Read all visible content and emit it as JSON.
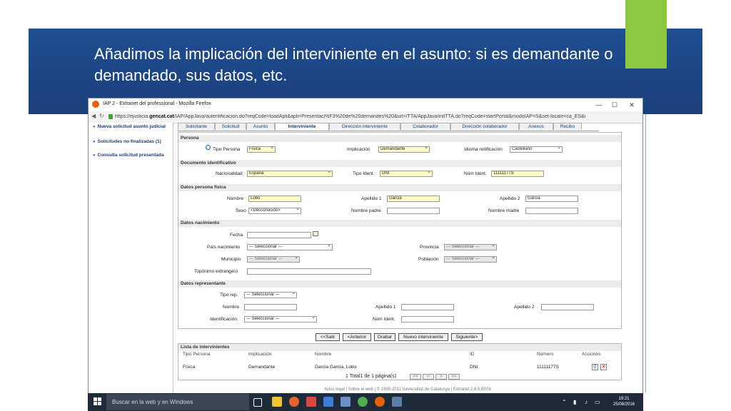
{
  "slide": {
    "title": "Añadimos la implicación del interviniente en el asunto: si es demandante o demandado, sus datos, etc.",
    "accent_color": "#8dc63f",
    "banner_color": "#1f4e93"
  },
  "browser": {
    "window_title": "IAP 2 - Extranet del professional - Mozilla Firefox",
    "url_prefix": "https://ejusticia.",
    "url_domain": "gencat.cat",
    "url_rest": "/IAP/AppJava/autentificacion.do?reqCode=loadApli&apli=Presentaci%F3%20de%20demandes%20&url=/TTA/AppJava/initTTA.do?reqCode=startPortal&modoIAP=S&set-locale=ca_ES&i",
    "minimize": "—",
    "maximize": "☐",
    "close": "✕",
    "back": "◀",
    "refresh": "↻"
  },
  "sidebar": {
    "items": [
      {
        "label": "Nueva solicitud asunto judicial"
      },
      {
        "label": "Solicitudes no finalizadas (1)"
      },
      {
        "label": "Consulta solicitud presentada"
      }
    ],
    "arrow": "»"
  },
  "tabs": [
    {
      "label": "Solicitante"
    },
    {
      "label": "Solicitud"
    },
    {
      "label": "Asunto"
    },
    {
      "label": "Interviniente",
      "active": true
    },
    {
      "label": "Dirección interviniente"
    },
    {
      "label": "Colaborador"
    },
    {
      "label": "Dirección colaborador"
    },
    {
      "label": "Anexos"
    },
    {
      "label": "Recibo"
    }
  ],
  "form": {
    "persona": {
      "section": "Persona",
      "tipo_persona_label": "Tipo Persona",
      "tipo_persona_value": "Física",
      "implicacion_label": "Implicación",
      "implicacion_value": "Demandante",
      "idioma_label": "Idioma notificación",
      "idioma_value": "Castellano"
    },
    "documento": {
      "section": "Documento identificativo",
      "nacionalidad_label": "Nacionalidad",
      "nacionalidad_value": "España",
      "tipo_ident_label": "Tipo Ident.",
      "tipo_ident_value": "DNI",
      "num_ident_label": "Núm Ident.",
      "num_ident_value": "11111177S"
    },
    "fisica": {
      "section": "Datos persona física",
      "nombre_label": "Nombre",
      "nombre_value": "Lobo",
      "apellido1_label": "Apellido 1",
      "apellido1_value": "Garcia",
      "apellido2_label": "Apellido 2",
      "apellido2_value": "Garcia",
      "sexo_label": "Sexo",
      "sexo_value": "<Desconocido>",
      "nombre_padre_label": "Nombre padre",
      "nombre_madre_label": "Nombre madre"
    },
    "nacimiento": {
      "section": "Datos nacimiento",
      "fecha_label": "Fecha",
      "pais_label": "País nacimiento",
      "pais_value": "--- Seleccionar ---",
      "provincia_label": "Provincia",
      "provincia_value": "--- Seleccionar ---",
      "municipio_label": "Municipio",
      "municipio_value": "--- Seleccionar ---",
      "poblacion_label": "Población",
      "poblacion_value": "--- Seleccionar ---",
      "toponimo_label": "Topónimo extrangero"
    },
    "representante": {
      "section": "Datos representante",
      "tipo_rep_label": "Tipo rep.",
      "tipo_rep_value": "--- Seleccionar ---",
      "nombre_label": "Nombre",
      "apellido1_label": "Apellido 1",
      "apellido2_label": "Apellido 2",
      "identificacion_label": "Identificación",
      "identificacion_value": "--- Seleccionar ---",
      "num_ident_label": "Núm Ident."
    }
  },
  "buttons": {
    "salir": "<<Salir",
    "anterior": "<Anterior",
    "grabar": "Grabar",
    "nuevo": "Nuevo interviniente",
    "siguiente": "Siguiente>"
  },
  "list": {
    "title": "Lista de intervinientes",
    "headers": [
      "Tipo Persona",
      "Implicación",
      "Nombre",
      "ID",
      "Número",
      "Acciones"
    ],
    "rows": [
      {
        "tipo": "Física",
        "implicacion": "Demandante",
        "nombre": "Garcia Garcia, Lobo",
        "id": "DNI",
        "numero": "11111177S"
      }
    ],
    "pager": "1 Total1 de 1 página(s)",
    "pager_buttons": [
      "<<",
      "<",
      ">",
      ">>"
    ]
  },
  "footer": "Aviso legal  |  Sobre el web  |  © 1995-2011 Generalitat de Catalunya  |  Extranet 2.8.5.B001",
  "taskbar": {
    "search_placeholder": "Buscar en la web y en Windows",
    "time": "19:21",
    "date": "25/08/2016"
  }
}
